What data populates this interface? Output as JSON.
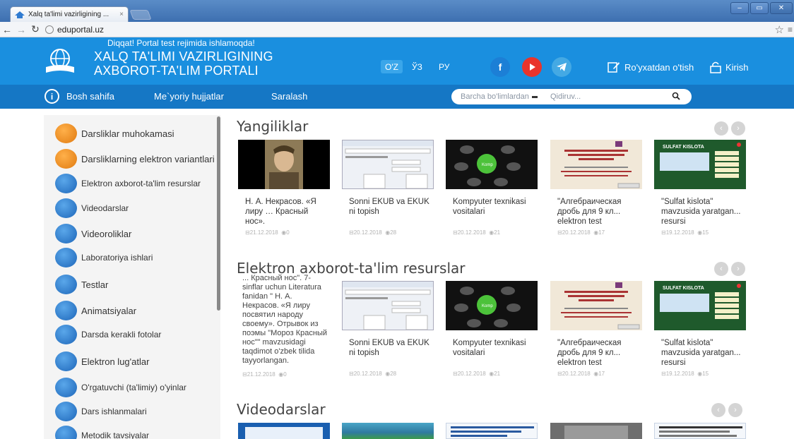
{
  "browser": {
    "tab_title": "Xalq ta'limi vazirligining ...",
    "tab_close": "×",
    "url": "eduportal.uz",
    "win_min": "–",
    "win_max": "▭",
    "win_close": "✕"
  },
  "header": {
    "note": "Diqqat! Portal test rejimida ishlamoqda!",
    "title_line1": "XALQ TA'LIMI VAZIRLIGINING",
    "title_line2": "AXBOROT-TA'LIM PORTALI",
    "langs": [
      "O'Z",
      "ЎЗ",
      "РУ"
    ],
    "fb_letter": "f",
    "register": "Ro'yxatdan o'tish",
    "login": "Kirish",
    "colors": {
      "header_bg": "#1a8fdf",
      "nav_bg": "#1577c5",
      "youtube": "#e9342b",
      "telegram": "#44a9e4"
    }
  },
  "nav": {
    "info_icon": "i",
    "items": [
      "Bosh sahifa",
      "Me`yoriy hujjatlar",
      "Saralash"
    ],
    "search_scope": "Barcha bo'limlardan",
    "search_placeholder": "Qidiruv...",
    "search_icon": "🔍"
  },
  "sidebar": {
    "items": [
      "Darsliklar muhokamasi",
      "Darsliklarning elektron variantlari",
      "Elektron axborot-ta'lim resurslar",
      "Videodarslar",
      "Videoroliklar",
      "Laboratoriya ishlari",
      "Testlar",
      "Animatsiyalar",
      "Darsda kerakli fotolar",
      "Elektron lug'atlar",
      "O'rgatuvchi (ta'limiy) o'yinlar",
      "Dars ishlanmalari",
      "Metodik tavsiyalar"
    ]
  },
  "sections": {
    "news_title": "Yangiliklar",
    "resources_title": "Elektron axborot-ta'lim resurslar",
    "video_title": "Videodarslar",
    "prev": "‹",
    "next": "›"
  },
  "news": [
    {
      "title": "Н. А. Некрасов. «Я лиру … Красный нос».",
      "date": "21.12.2018",
      "views": "0"
    },
    {
      "title": "Sonni EKUB va EKUK ni topish",
      "date": "20.12.2018",
      "views": "28"
    },
    {
      "title": "Kompyuter texnikasi vositalari",
      "date": "20.12.2018",
      "views": "21"
    },
    {
      "title": "\"Алгебраическая дробь для 9 кл... elektron test",
      "date": "20.12.2018",
      "views": "17"
    },
    {
      "title": "\"Sulfat kislota\" mavzusida yaratgan... resursi",
      "date": "19.12.2018",
      "views": "15"
    }
  ],
  "resources": {
    "first_text": "... Красный нос\". 7-sinflar uchun Literatura fanidan \" Н. А. Некрасов. «Я лиру посвятил народу своему». Отрывок из поэмы \"Мороз Красный нос\"\" mavzusidagi taqdimot o'zbek tilida tayyorlangan.",
    "first_date": "21.12.2018",
    "first_views": "0",
    "items": [
      {
        "title": "Sonni EKUB va EKUK ni topish",
        "date": "20.12.2018",
        "views": "28"
      },
      {
        "title": "Kompyuter texnikasi vositalari",
        "date": "20.12.2018",
        "views": "21"
      },
      {
        "title": "\"Алгебраическая дробь для 9 кл... elektron test",
        "date": "20.12.2018",
        "views": "17"
      },
      {
        "title": "\"Sulfat kislota\" mavzusida yaratgan... resursi",
        "date": "19.12.2018",
        "views": "15"
      }
    ]
  },
  "thumb_text": {
    "sulfat": "SULFAT KISLOTA",
    "komp": "Komp"
  }
}
